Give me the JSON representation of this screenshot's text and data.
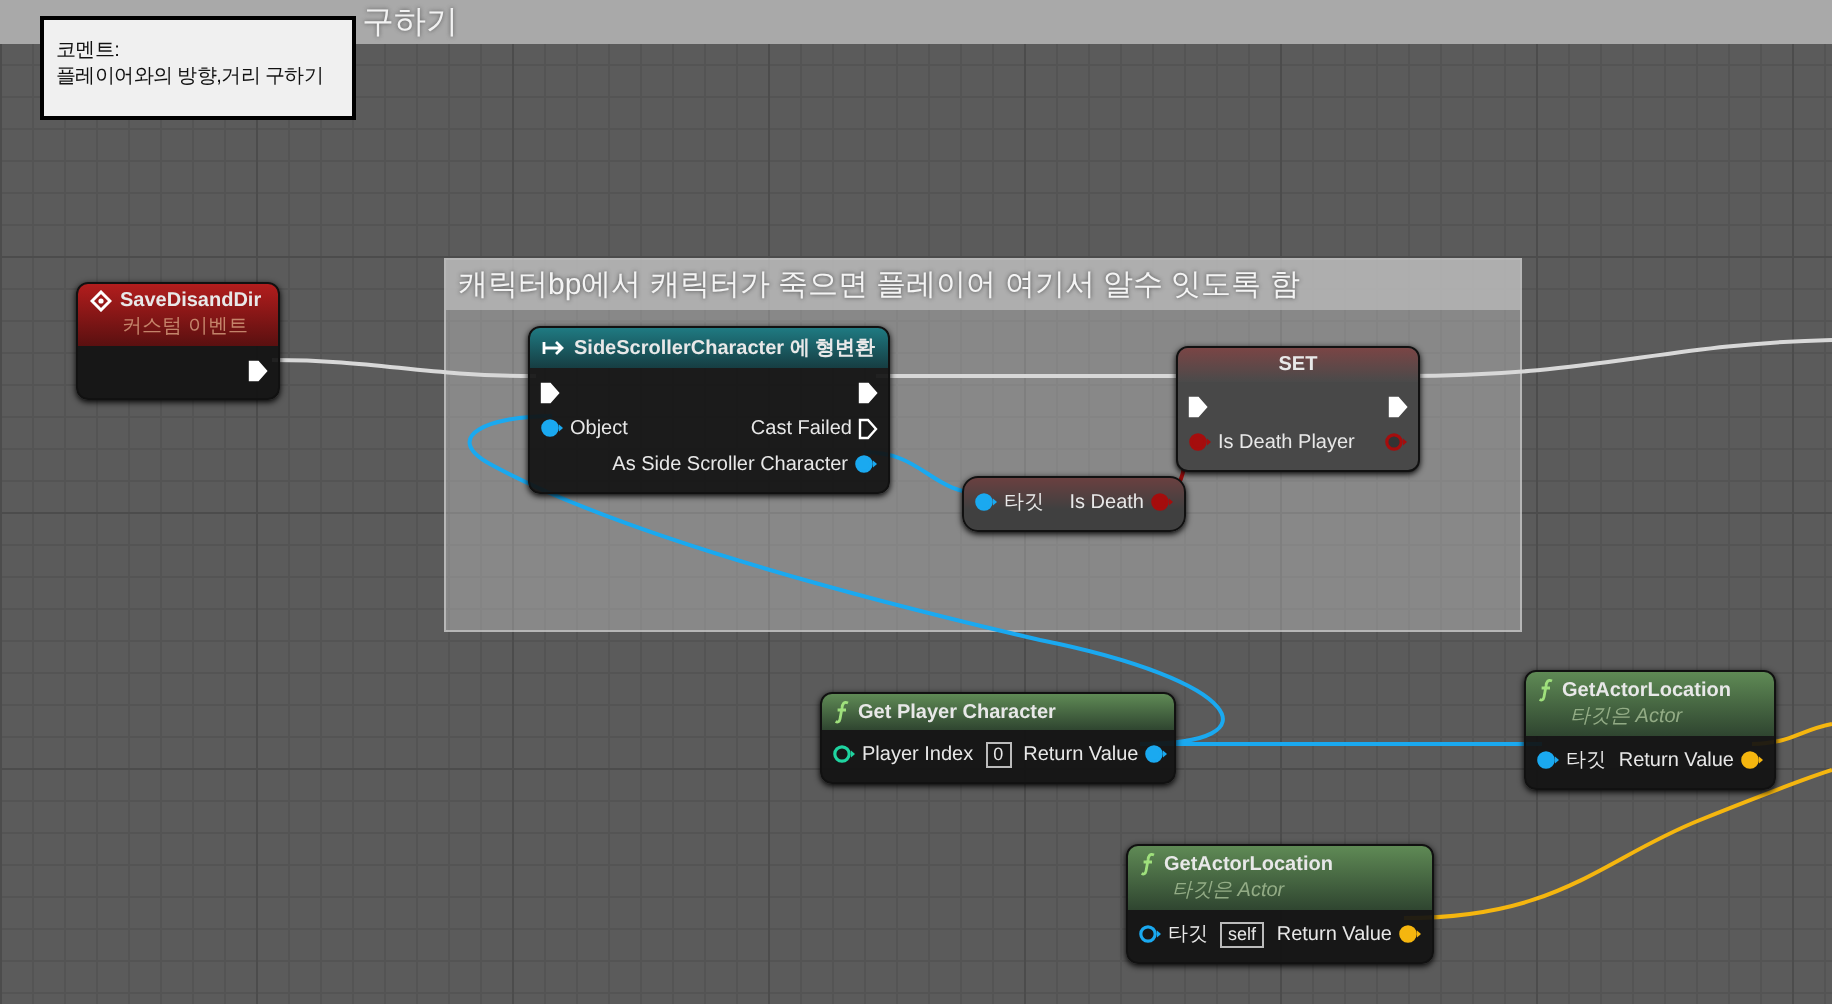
{
  "graph_title": "구하기",
  "tooltip": {
    "heading": "코멘트:",
    "text": "플레이어와의 방향,거리 구하기"
  },
  "comment": {
    "text": "캐릭터bp에서 캐릭터가 죽으면 플레이어 여기서 알수 잇도록 함"
  },
  "nodes": [
    {
      "kind": "event",
      "title": "SaveDisandDir",
      "subtitle": "커스텀 이벤트",
      "outputs": [
        {
          "kind": "exec",
          "connected": true
        }
      ]
    },
    {
      "kind": "cast",
      "title": "SideScrollerCharacter 에 형변환",
      "inputs": [
        {
          "kind": "exec",
          "connected": true
        },
        {
          "kind": "data",
          "label": "Object",
          "color": "#1aa9f0",
          "connected": true
        }
      ],
      "outputs": [
        {
          "kind": "exec",
          "connected": true
        },
        {
          "kind": "exec",
          "label": "Cast Failed",
          "connected": false
        },
        {
          "kind": "data",
          "label": "As Side Scroller Character",
          "color": "#1aa9f0",
          "connected": true
        }
      ]
    },
    {
      "kind": "variable",
      "inputs": [
        {
          "kind": "data",
          "label": "타깃",
          "color": "#1aa9f0",
          "connected": true
        }
      ],
      "outputs": [
        {
          "kind": "data",
          "label": "Is Death",
          "color": "#a50d0d",
          "connected": true
        }
      ]
    },
    {
      "kind": "set",
      "title": "SET",
      "inputs": [
        {
          "kind": "exec",
          "connected": true
        },
        {
          "kind": "data",
          "label": "Is Death Player",
          "color": "#a50d0d",
          "connected": true
        }
      ],
      "outputs": [
        {
          "kind": "exec",
          "connected": true
        },
        {
          "kind": "data",
          "color": "#a50d0d",
          "connected": false
        }
      ]
    },
    {
      "kind": "function",
      "title": "Get Player Character",
      "inputs": [
        {
          "kind": "data",
          "label": "Player Index",
          "color": "#1fd4a0",
          "connected": false,
          "default": "0"
        }
      ],
      "outputs": [
        {
          "kind": "data",
          "label": "Return Value",
          "color": "#1aa9f0",
          "connected": true
        }
      ]
    },
    {
      "kind": "function",
      "title": "GetActorLocation",
      "subtitle": "타깃은 Actor",
      "inputs": [
        {
          "kind": "data",
          "label": "타깃",
          "color": "#1aa9f0",
          "connected": true
        }
      ],
      "outputs": [
        {
          "kind": "data",
          "label": "Return Value",
          "color": "#f5b60f",
          "connected": true
        }
      ]
    },
    {
      "kind": "function",
      "title": "GetActorLocation",
      "subtitle": "타깃은 Actor",
      "inputs": [
        {
          "kind": "data",
          "label": "타깃",
          "color": "#1aa9f0",
          "connected": false,
          "default": "self"
        }
      ],
      "outputs": [
        {
          "kind": "data",
          "label": "Return Value",
          "color": "#f5b60f",
          "connected": true
        }
      ]
    }
  ]
}
